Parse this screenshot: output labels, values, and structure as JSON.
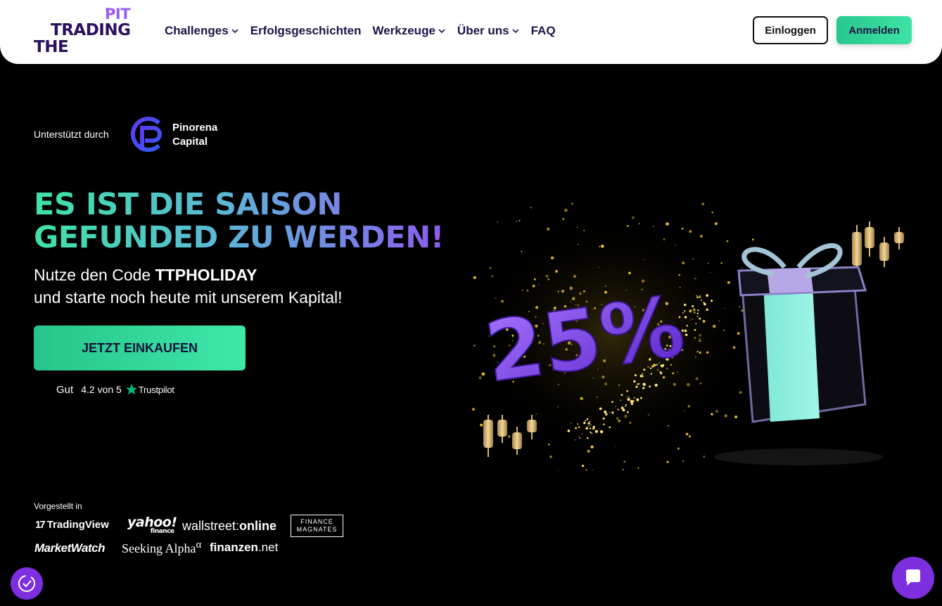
{
  "logo": {
    "line1": "PIT",
    "mark": "®",
    "line2": "TRADING",
    "line3": "THE"
  },
  "nav": {
    "items": [
      {
        "label": "Challenges",
        "has_dropdown": true
      },
      {
        "label": "Erfolgsgeschichten",
        "has_dropdown": false
      },
      {
        "label": "Werkzeuge",
        "has_dropdown": true
      },
      {
        "label": "Über uns",
        "has_dropdown": true
      },
      {
        "label": "FAQ",
        "has_dropdown": false
      }
    ]
  },
  "header": {
    "login_label": "Einloggen",
    "register_label": "Anmelden"
  },
  "hero": {
    "supported_by": "Unterstützt durch",
    "partner_line1": "Pinorena",
    "partner_line2": "Capital",
    "headline_line1": "ES IST DIE SAISON",
    "headline_line2": "GEFUNDED ZU WERDEN!",
    "sub_prefix": "Nutze den Code ",
    "sub_code": "TTPHOLIDAY",
    "sub_line2": "und starte noch heute mit unserem Kapital!",
    "cta_label": "JETZT EINKAUFEN",
    "promo_text": "25%"
  },
  "trustpilot": {
    "rating_word": "Gut",
    "score_text": "4.2 von 5",
    "brand": "Trustpilot"
  },
  "featured": {
    "label": "Vorgestellt in",
    "logos": {
      "tradingview_mark": "17",
      "tradingview": "TradingView",
      "yahoo": "yahoo!",
      "yahoo_sub": "finance",
      "wso_prefix": "wallstreet:",
      "wso_suffix": "online",
      "fm_line1": "FINANCE",
      "fm_line2": "MAGNATES",
      "marketwatch": "MarketWatch",
      "seeking_alpha": "Seeking Alpha",
      "seeking_alpha_mark": "α",
      "finanzen": "finanzen",
      "finanzen_suffix": ".net"
    }
  },
  "colors": {
    "brand_purple": "#7d2fe0",
    "brand_green": "#3ee3a5",
    "navy": "#1e1147",
    "background": "#000000"
  },
  "icons": {
    "nav_chevron": "chevron-down-icon",
    "cookie": "cookie-settings-icon",
    "chat": "chat-bubble-icon",
    "star": "trustpilot-star-icon"
  }
}
